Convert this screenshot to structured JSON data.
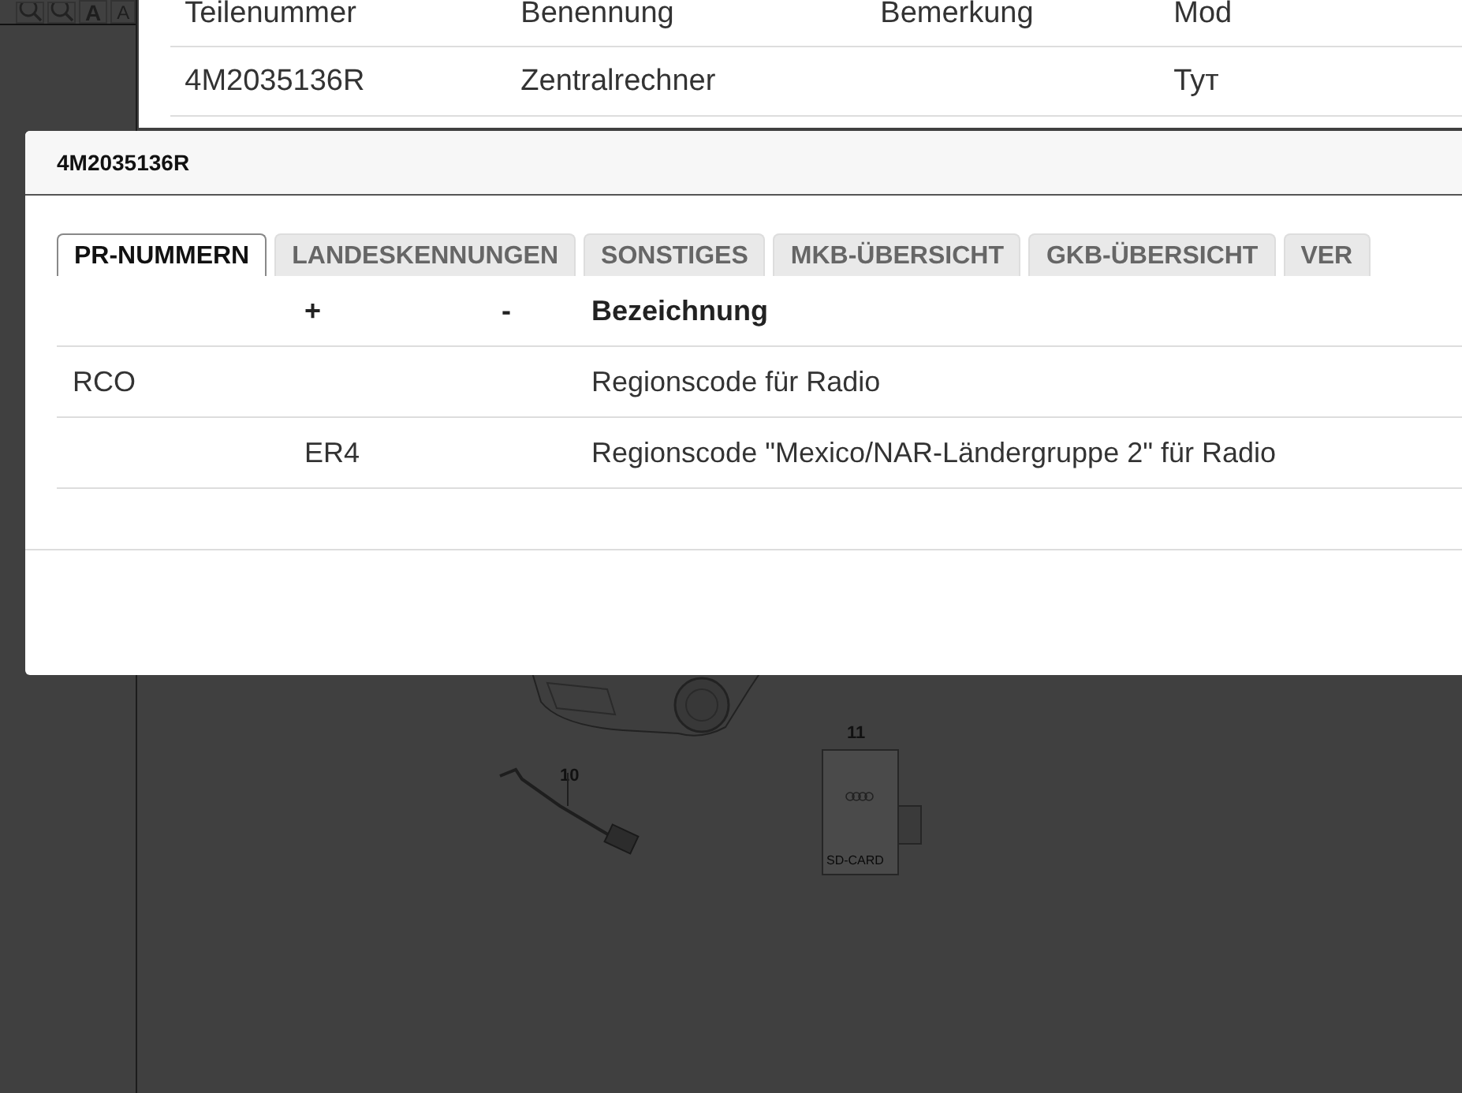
{
  "toolbar": {
    "font_buttons": [
      "A",
      "A"
    ]
  },
  "parts_table": {
    "columns": [
      "Teilenummer",
      "Benennung",
      "Bemerkung",
      "Mod"
    ],
    "rows": [
      {
        "cells": [
          "4M2035136R",
          "Zentralrechner",
          "",
          "Тут"
        ]
      }
    ]
  },
  "diagram": {
    "callouts": [
      "10",
      "11"
    ],
    "card_label": "SD-CARD"
  },
  "dialog": {
    "title": "4M2035136R",
    "tabs": [
      {
        "label": "PR-NUMMERN",
        "selected": true
      },
      {
        "label": "LANDESKENNUNGEN",
        "selected": false
      },
      {
        "label": "SONSTIGES",
        "selected": false
      },
      {
        "label": "MKB-ÜBERSICHT",
        "selected": false
      },
      {
        "label": "GKB-ÜBERSICHT",
        "selected": false
      },
      {
        "label": "VER",
        "selected": false
      }
    ],
    "columns": [
      "",
      "+",
      "-",
      "Bezeichnung"
    ],
    "rows": [
      {
        "cells": [
          "RCO",
          "",
          "",
          "Regionscode für Radio"
        ]
      },
      {
        "cells": [
          "",
          "ER4",
          "",
          "Regionscode \"Mexico/NAR-Ländergruppe 2\" für Radio"
        ]
      }
    ]
  }
}
